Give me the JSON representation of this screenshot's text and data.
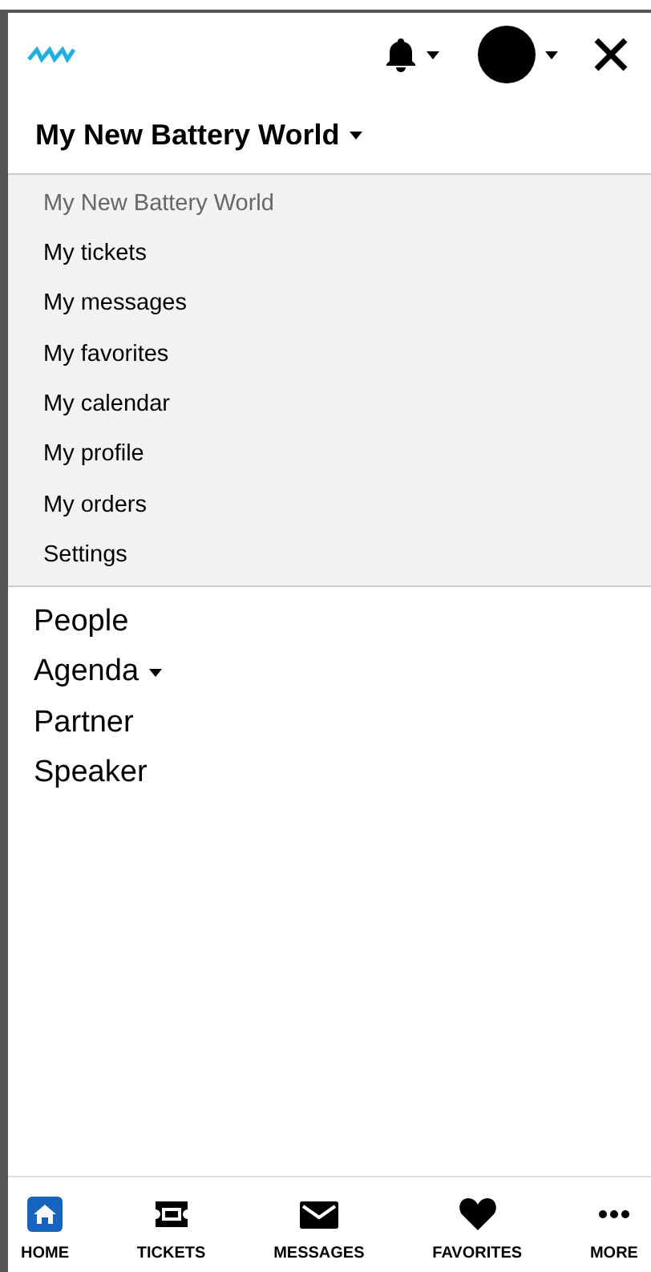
{
  "header": {
    "title": "My New Battery World"
  },
  "submenu": [
    {
      "label": "My New Battery World",
      "selected": true
    },
    {
      "label": "My tickets",
      "selected": false
    },
    {
      "label": "My messages",
      "selected": false
    },
    {
      "label": "My favorites",
      "selected": false
    },
    {
      "label": "My calendar",
      "selected": false
    },
    {
      "label": "My profile",
      "selected": false
    },
    {
      "label": "My orders",
      "selected": false
    },
    {
      "label": "Settings",
      "selected": false
    }
  ],
  "menu": [
    {
      "label": "People",
      "kind": "link"
    },
    {
      "label": "Agenda",
      "kind": "dropdown"
    },
    {
      "label": "Partner",
      "kind": "link"
    },
    {
      "label": "Speaker",
      "kind": "link"
    }
  ],
  "bottom_nav": [
    {
      "label": "HOME",
      "selected": true
    },
    {
      "label": "TICKETS",
      "selected": false
    },
    {
      "label": "MESSAGES",
      "selected": false
    },
    {
      "label": "FAVORITES",
      "selected": false
    },
    {
      "label": "MORE",
      "selected": false
    }
  ]
}
